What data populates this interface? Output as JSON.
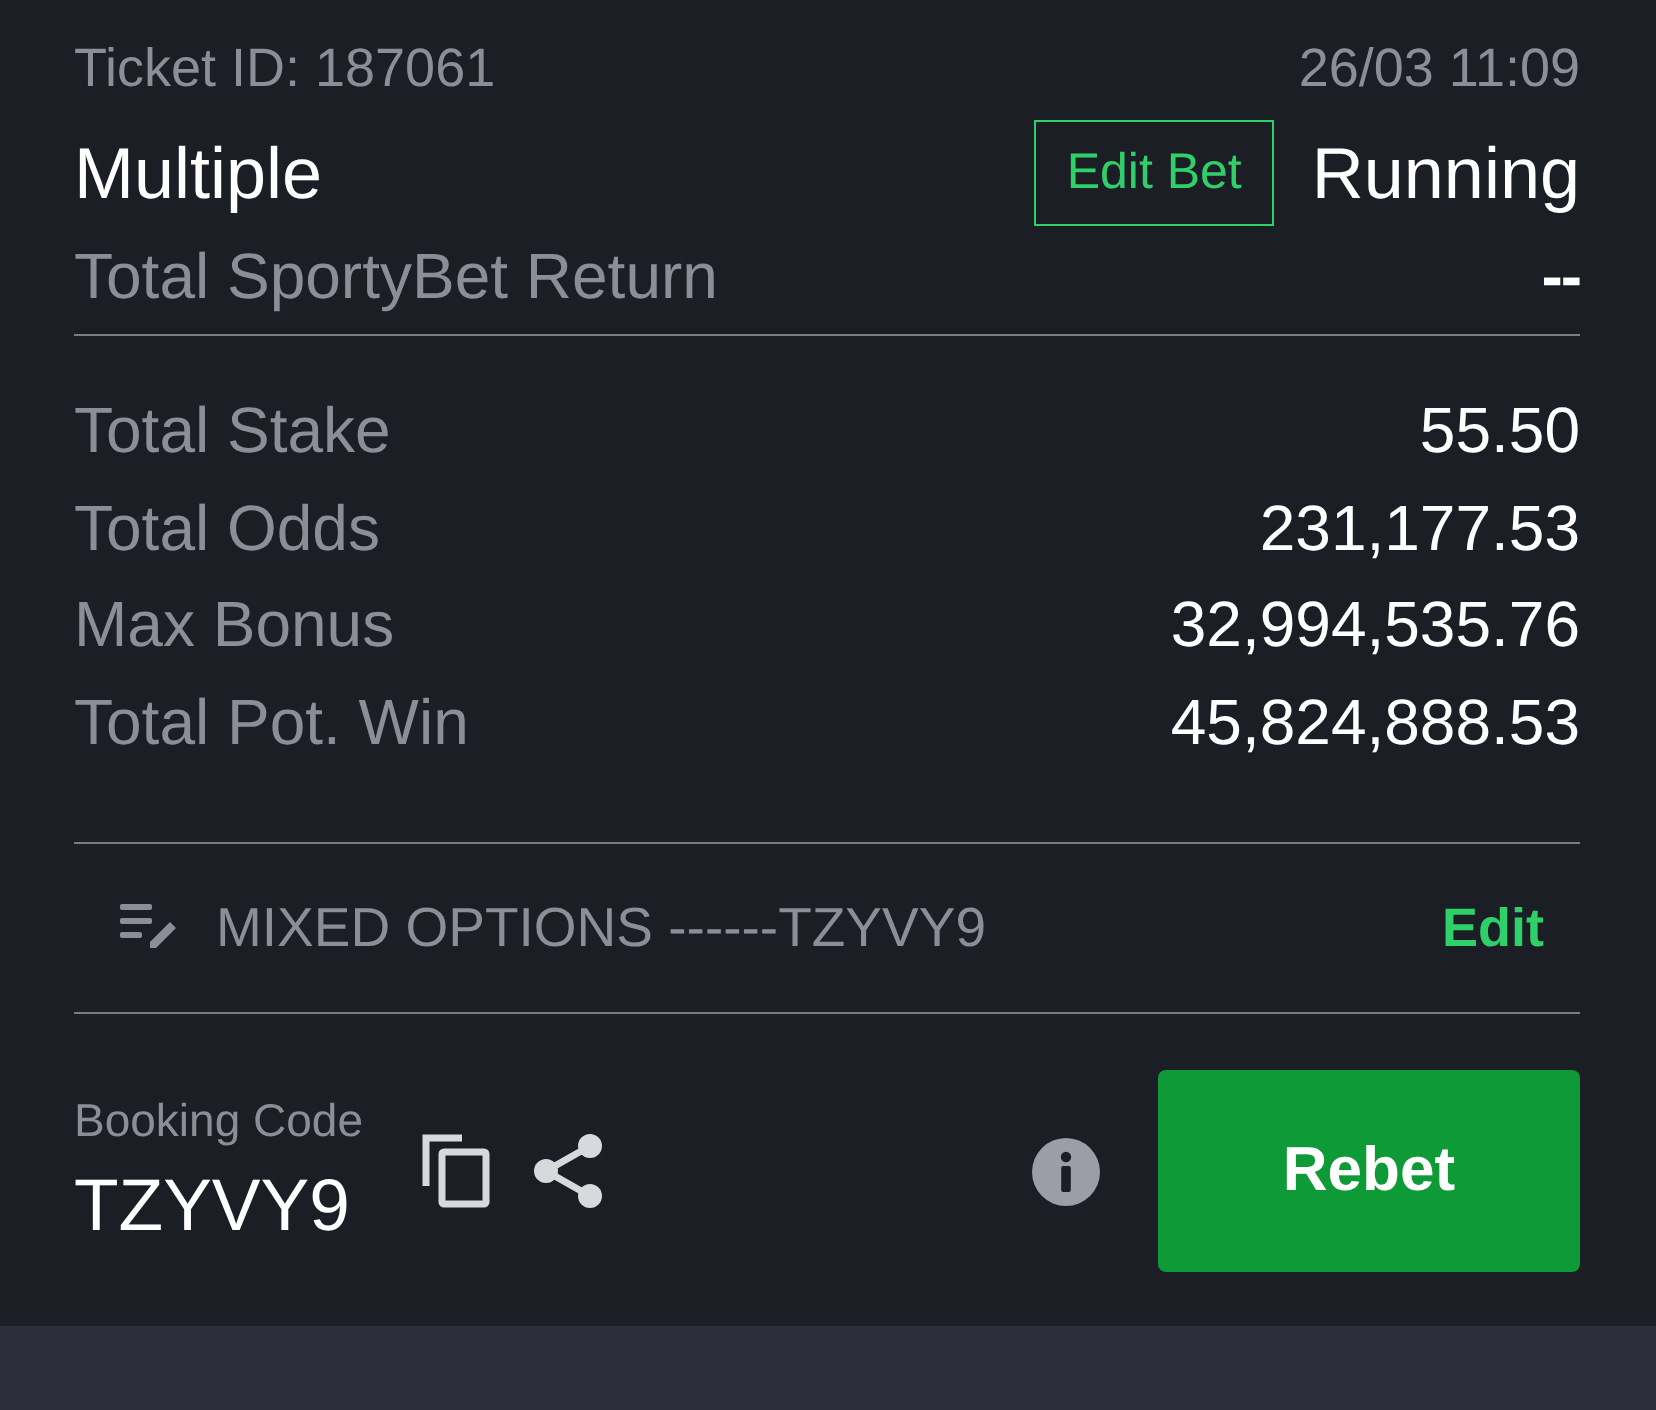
{
  "ticket": {
    "id_label": "Ticket ID: 187061",
    "datetime": "26/03 11:09",
    "type": "Multiple",
    "edit_bet_button": "Edit Bet",
    "status": "Running",
    "return_label": "Total SportyBet Return",
    "return_value": "--"
  },
  "summary": [
    {
      "label": "Total Stake",
      "value": "55.50"
    },
    {
      "label": "Total Odds",
      "value": "231,177.53"
    },
    {
      "label": "Max Bonus",
      "value": "32,994,535.76"
    },
    {
      "label": "Total Pot. Win",
      "value": "45,824,888.53"
    }
  ],
  "options": {
    "text": "MIXED OPTIONS ------TZYVY9",
    "edit_link": "Edit"
  },
  "booking": {
    "label": "Booking Code",
    "code": "TZYVY9",
    "rebet_button": "Rebet"
  }
}
